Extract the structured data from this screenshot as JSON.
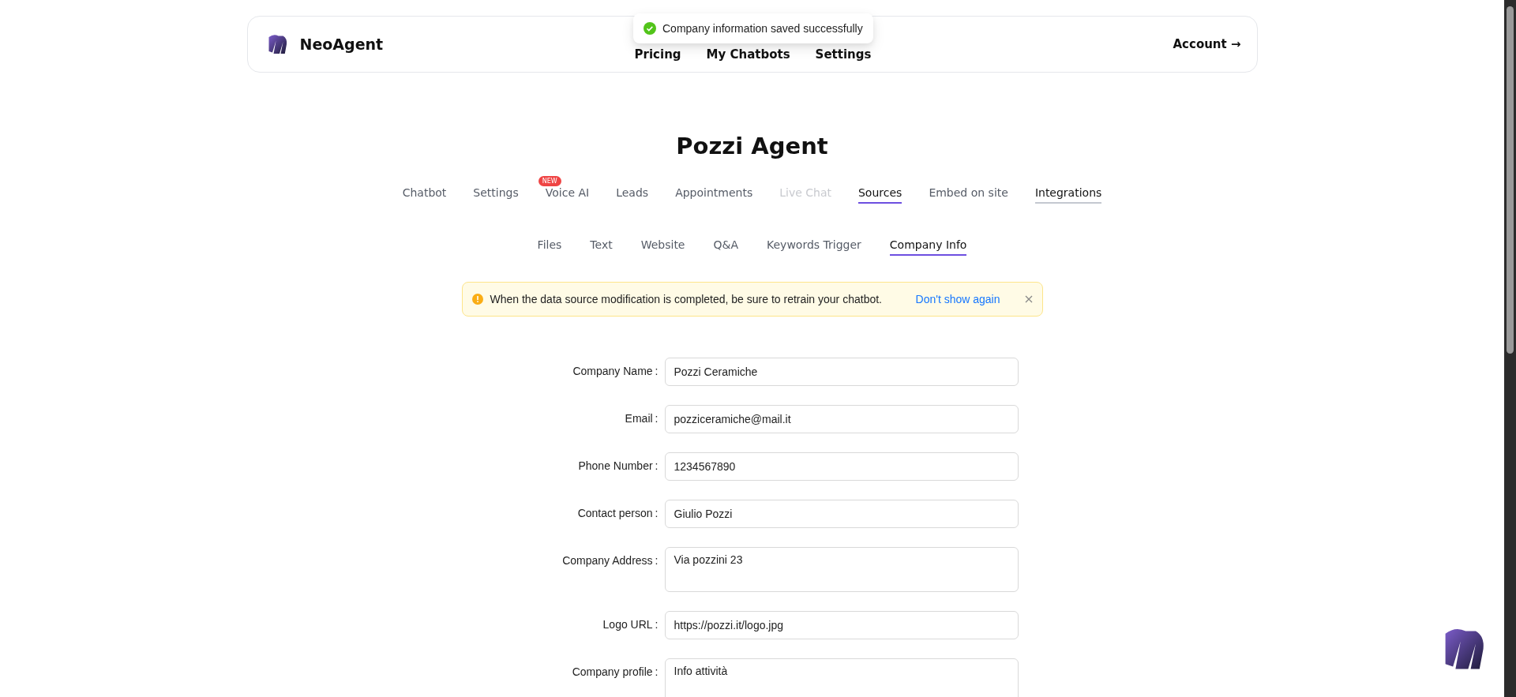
{
  "header": {
    "brand": "NeoAgent",
    "nav": [
      "Pricing",
      "My Chatbots",
      "Settings"
    ],
    "account": "Account →"
  },
  "toast": {
    "message": "Company information saved successfully"
  },
  "title": "Pozzi Agent",
  "tabs": [
    {
      "label": "Chatbot",
      "selected": false,
      "disabled": false,
      "hovered": false
    },
    {
      "label": "Settings",
      "selected": false,
      "disabled": false,
      "hovered": false
    },
    {
      "label": "Voice AI",
      "selected": false,
      "disabled": false,
      "hovered": false,
      "badge": "NEW"
    },
    {
      "label": "Leads",
      "selected": false,
      "disabled": false,
      "hovered": false
    },
    {
      "label": "Appointments",
      "selected": false,
      "disabled": false,
      "hovered": false
    },
    {
      "label": "Live Chat",
      "selected": false,
      "disabled": true,
      "hovered": false
    },
    {
      "label": "Sources",
      "selected": true,
      "disabled": false,
      "hovered": false
    },
    {
      "label": "Embed on site",
      "selected": false,
      "disabled": false,
      "hovered": false
    },
    {
      "label": "Integrations",
      "selected": false,
      "disabled": false,
      "hovered": true
    }
  ],
  "subtabs": [
    {
      "label": "Files",
      "selected": false
    },
    {
      "label": "Text",
      "selected": false
    },
    {
      "label": "Website",
      "selected": false
    },
    {
      "label": "Q&A",
      "selected": false
    },
    {
      "label": "Keywords Trigger",
      "selected": false
    },
    {
      "label": "Company Info",
      "selected": true
    }
  ],
  "alert": {
    "message": "When the data source modification is completed, be sure to retrain your chatbot.",
    "action": "Don't show again"
  },
  "form": [
    {
      "label": "Company Name",
      "colon": ":",
      "value": "Pozzi Ceramiche",
      "kind": "input"
    },
    {
      "label": "Email",
      "colon": ":",
      "value": "pozziceramiche@mail.it",
      "kind": "input"
    },
    {
      "label": "Phone Number",
      "colon": ":",
      "value": "1234567890",
      "kind": "input"
    },
    {
      "label": "Contact person",
      "colon": ":",
      "value": "Giulio Pozzi",
      "kind": "input"
    },
    {
      "label": "Company Address",
      "colon": ":",
      "value": "Via pozzini 23",
      "kind": "textarea"
    },
    {
      "label": "Logo URL",
      "colon": ":",
      "value": "https://pozzi.it/logo.jpg",
      "kind": "input"
    },
    {
      "label": "Company profile",
      "colon": ":",
      "value": "Info attività",
      "kind": "tallarea"
    }
  ]
}
